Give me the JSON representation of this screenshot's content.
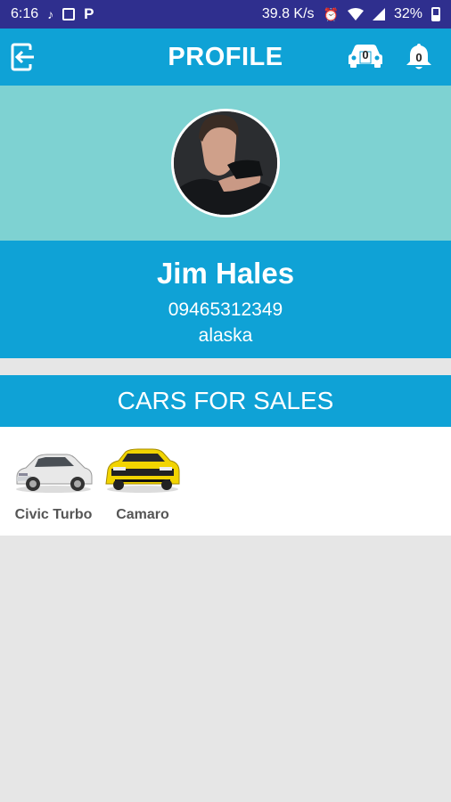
{
  "status_bar": {
    "time": "6:16",
    "network_speed": "39.8 K/s",
    "battery": "32%"
  },
  "app_bar": {
    "title": "PROFILE",
    "car_badge": "0",
    "notification_badge": "0"
  },
  "profile": {
    "name": "Jim Hales",
    "phone": "09465312349",
    "location": "alaska"
  },
  "cars_section": {
    "title": "CARS FOR SALES",
    "cars": [
      {
        "name": "Civic Turbo",
        "color": "#e8e8e8"
      },
      {
        "name": "Camaro",
        "color": "#f2d400"
      }
    ]
  },
  "colors": {
    "status_bar": "#2f2f8e",
    "primary": "#0fa2d6",
    "avatar_band": "#7ed2d2",
    "background": "#e6e6e6"
  }
}
